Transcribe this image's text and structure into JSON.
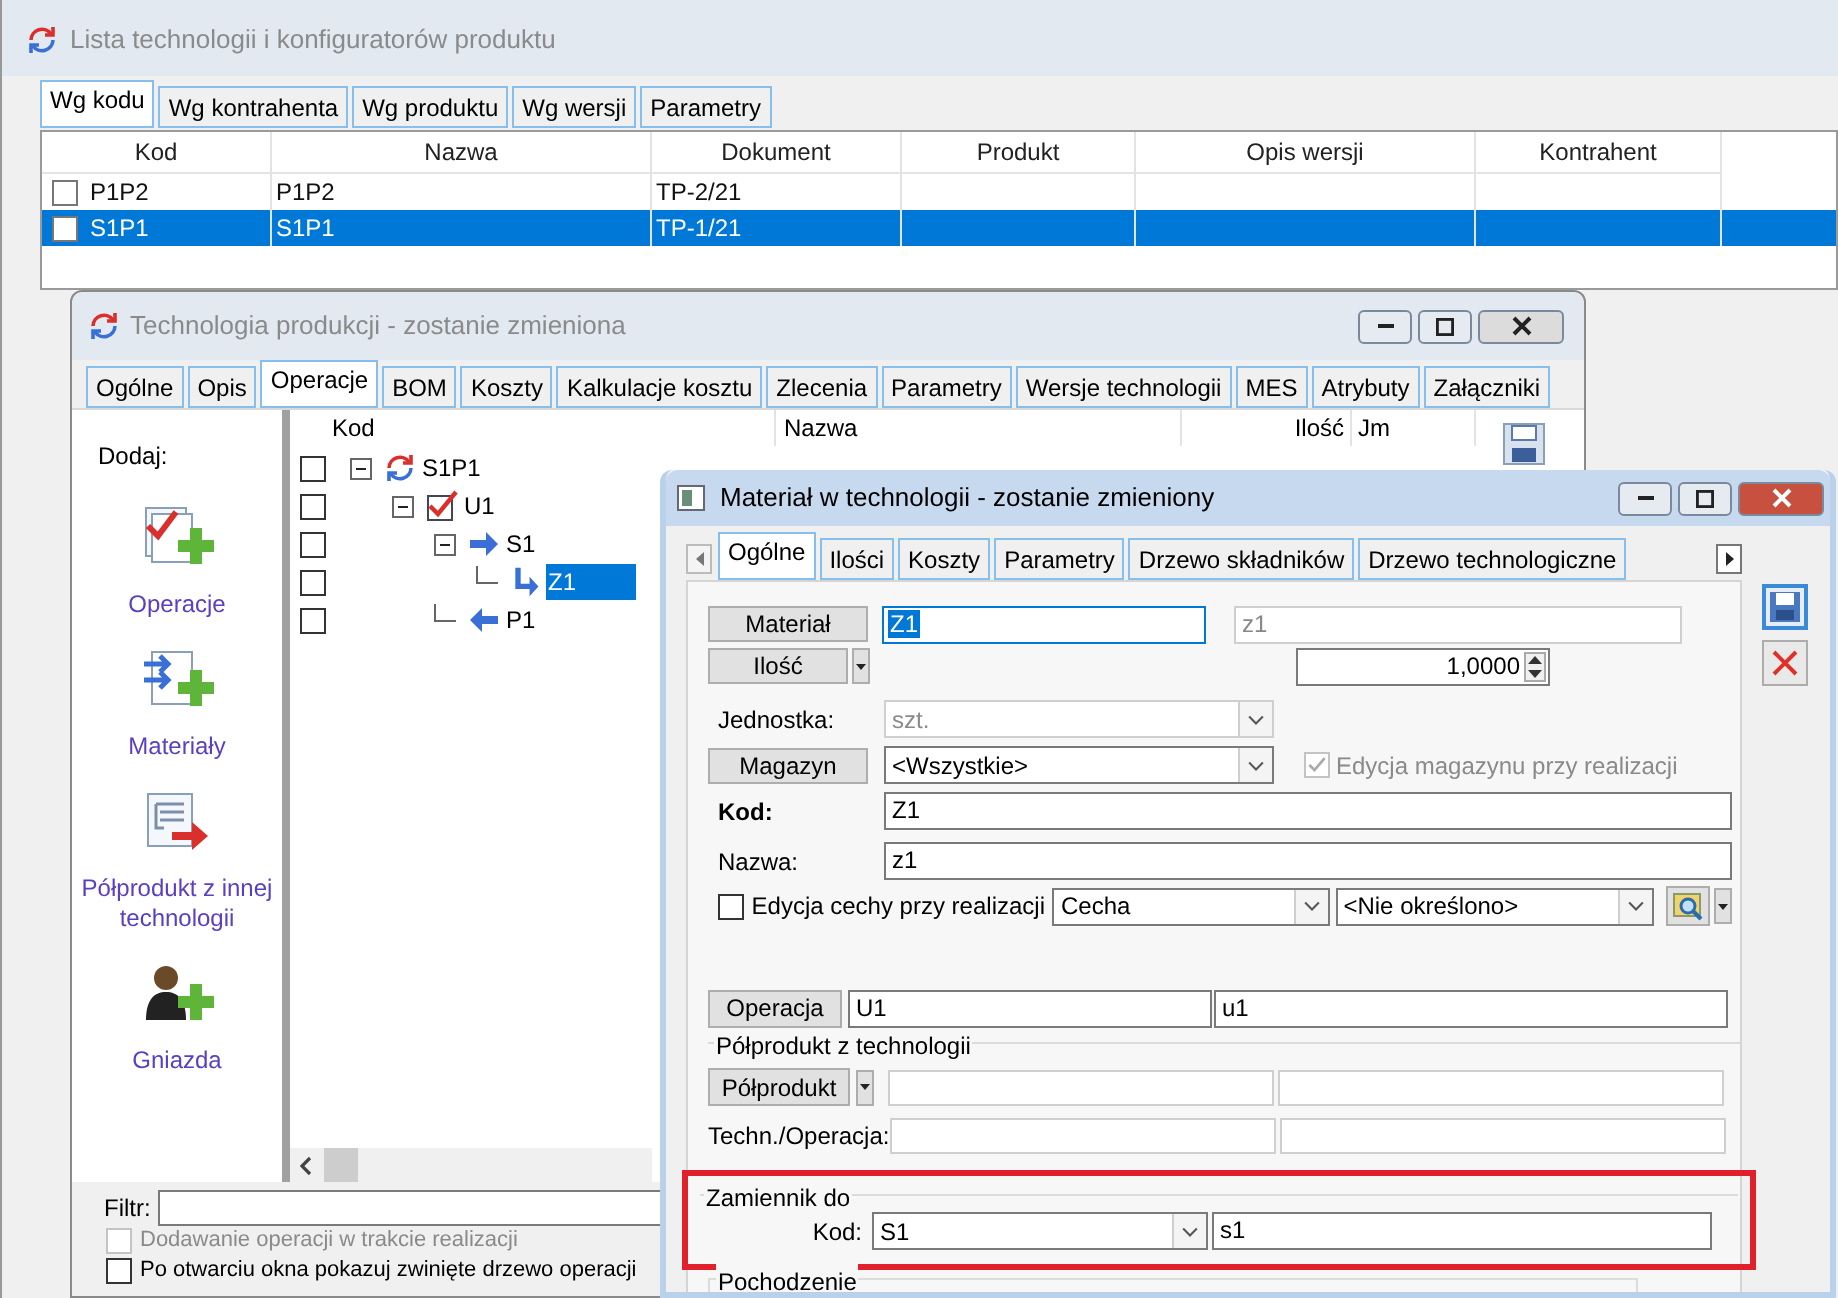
{
  "list_window": {
    "title": "Lista technologii i konfiguratorów produktu",
    "tabs": [
      {
        "label": "Wg kodu",
        "selected": true
      },
      {
        "label": "Wg kontrahenta",
        "selected": false
      },
      {
        "label": "Wg produktu",
        "selected": false
      },
      {
        "label": "Wg wersji",
        "selected": false
      },
      {
        "label": "Parametry",
        "selected": false
      }
    ],
    "columns": [
      "Kod",
      "Nazwa",
      "Dokument",
      "Produkt",
      "Opis wersji",
      "Kontrahent"
    ],
    "rows": [
      {
        "kod": "P1P2",
        "nazwa": "P1P2",
        "dokument": "TP-2/21",
        "checked": false,
        "selected": false
      },
      {
        "kod": "S1P1",
        "nazwa": "S1P1",
        "dokument": "TP-1/21",
        "checked": false,
        "selected": true
      }
    ]
  },
  "tech_window": {
    "title": "Technologia produkcji - zostanie zmieniona",
    "tabs": [
      {
        "label": "Ogólne",
        "selected": false
      },
      {
        "label": "Opis",
        "selected": false
      },
      {
        "label": "Operacje",
        "selected": true
      },
      {
        "label": "BOM",
        "selected": false
      },
      {
        "label": "Koszty",
        "selected": false
      },
      {
        "label": "Kalkulacje kosztu",
        "selected": false
      },
      {
        "label": "Zlecenia",
        "selected": false
      },
      {
        "label": "Parametry",
        "selected": false
      },
      {
        "label": "Wersje technologii",
        "selected": false
      },
      {
        "label": "MES",
        "selected": false
      },
      {
        "label": "Atrybuty",
        "selected": false
      },
      {
        "label": "Załączniki",
        "selected": false
      }
    ],
    "add_label": "Dodaj:",
    "add_actions": [
      {
        "label": "Operacje",
        "kind": "operation"
      },
      {
        "label": "Materiały",
        "kind": "material"
      },
      {
        "label": "Półprodukt z innej technologii",
        "kind": "semi_product"
      },
      {
        "label": "Gniazda",
        "kind": "work_center"
      }
    ],
    "tree_columns": [
      "Kod",
      "Nazwa",
      "Ilość",
      "Jm"
    ],
    "tree": [
      {
        "label": "S1P1",
        "kind": "technology",
        "expanded": true,
        "selected": false,
        "checked": false,
        "children": [
          {
            "label": "U1",
            "kind": "operation",
            "expanded": true,
            "selected": false,
            "checked": false,
            "children": [
              {
                "label": "S1",
                "kind": "input",
                "expanded": true,
                "selected": false,
                "checked": false,
                "children": [
                  {
                    "label": "Z1",
                    "kind": "substitute",
                    "selected": true,
                    "checked": false
                  }
                ]
              },
              {
                "label": "P1",
                "kind": "output",
                "selected": false,
                "checked": false
              }
            ]
          }
        ]
      }
    ],
    "filter_label": "Filtr:",
    "options": [
      {
        "label": "Dodawanie operacji w trakcie realizacji",
        "checked": false,
        "disabled": true
      },
      {
        "label": "Po otwarciu okna pokazuj zwinięte drzewo operacji",
        "checked": false,
        "disabled": false
      }
    ]
  },
  "material_window": {
    "title": "Materiał w technologii - zostanie zmieniony",
    "tabs": [
      {
        "label": "Ogólne",
        "selected": true
      },
      {
        "label": "Ilości",
        "selected": false
      },
      {
        "label": "Koszty",
        "selected": false
      },
      {
        "label": "Parametry",
        "selected": false
      },
      {
        "label": "Drzewo składników",
        "selected": false
      },
      {
        "label": "Drzewo technologiczne",
        "selected": false
      }
    ],
    "material": {
      "button": "Materiał",
      "code": "Z1",
      "name": "z1"
    },
    "quantity": {
      "button": "Ilość",
      "value": "1,0000"
    },
    "unit": {
      "label": "Jednostka:",
      "value": "szt.",
      "disabled": true
    },
    "warehouse": {
      "button": "Magazyn",
      "value": "<Wszystkie>",
      "option_label": "Edycja magazynu przy realizacji",
      "option_checked": true,
      "option_disabled": true
    },
    "code": {
      "label": "Kod:",
      "value": "Z1"
    },
    "name": {
      "label": "Nazwa:",
      "value": "z1"
    },
    "feature": {
      "label": "Edycja cechy przy realizacji",
      "checked": false,
      "type": "Cecha",
      "value": "<Nie określono>"
    },
    "operation": {
      "button": "Operacja",
      "code": "U1",
      "name": "u1"
    },
    "semi_product": {
      "title": "Półprodukt z technologii",
      "button": "Półprodukt",
      "techn_label": "Techn./Operacja:"
    },
    "substitute": {
      "title": "Zamiennik do",
      "label": "Kod:",
      "code": "S1",
      "name": "s1",
      "highlighted": true
    },
    "origin": {
      "title": "Pochodzenie"
    }
  }
}
